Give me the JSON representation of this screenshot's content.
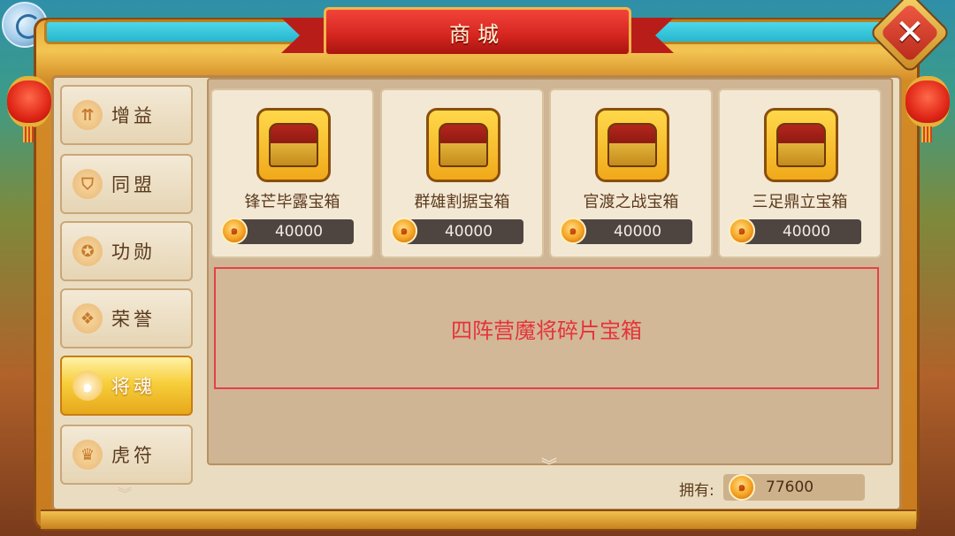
{
  "window": {
    "title": "商城"
  },
  "sidebar": {
    "items": [
      {
        "label": "增益",
        "icon": "buff-icon",
        "glyph": "⇈",
        "active": false
      },
      {
        "label": "同盟",
        "icon": "alliance-banner-icon",
        "glyph": "⛉",
        "active": false
      },
      {
        "label": "功勋",
        "icon": "merit-icon",
        "glyph": "✪",
        "active": false
      },
      {
        "label": "荣誉",
        "icon": "honor-icon",
        "glyph": "❖",
        "active": false
      },
      {
        "label": "将魂",
        "icon": "soul-flame-icon",
        "glyph": "๑",
        "active": true
      },
      {
        "label": "虎符",
        "icon": "tiger-token-icon",
        "glyph": "♛",
        "active": false
      }
    ]
  },
  "shop": {
    "items": [
      {
        "name": "锋芒毕露宝箱",
        "price": "40000",
        "icon": "treasure-chest-icon"
      },
      {
        "name": "群雄割据宝箱",
        "price": "40000",
        "icon": "treasure-chest-icon"
      },
      {
        "name": "官渡之战宝箱",
        "price": "40000",
        "icon": "treasure-chest-icon"
      },
      {
        "name": "三足鼎立宝箱",
        "price": "40000",
        "icon": "treasure-chest-icon"
      }
    ],
    "detail_text": "四阵营魔将碎片宝箱"
  },
  "footer": {
    "owned_label": "拥有:",
    "owned_amount": "77600",
    "currency_icon": "soul-coin-icon"
  },
  "colors": {
    "accent_red": "#e5414a",
    "active_tab": "#f7cf3c",
    "frame_gold": "#d38b26"
  }
}
